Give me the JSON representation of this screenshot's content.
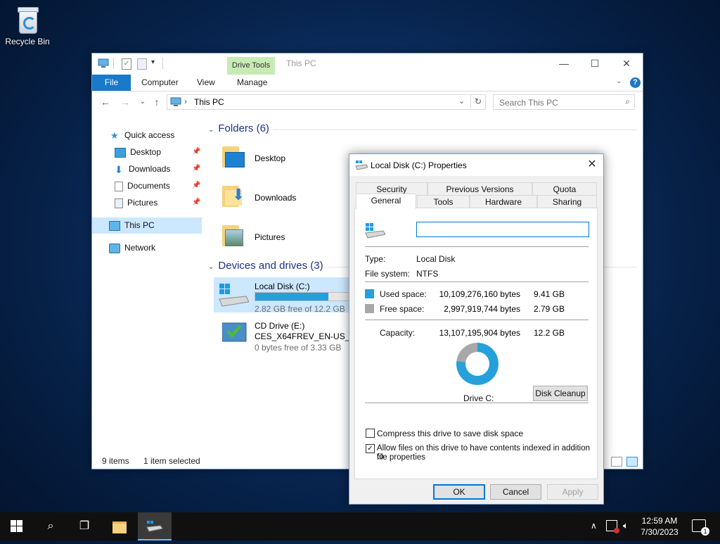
{
  "desktop": {
    "recycle_bin": "Recycle Bin"
  },
  "explorer": {
    "title": "This PC",
    "context_tab": "Drive Tools",
    "tabs": {
      "file": "File",
      "computer": "Computer",
      "view": "View",
      "manage": "Manage"
    },
    "address": "This PC",
    "search_placeholder": "Search This PC",
    "nav": {
      "quick_access": "Quick access",
      "desktop": "Desktop",
      "downloads": "Downloads",
      "documents": "Documents",
      "pictures": "Pictures",
      "this_pc": "This PC",
      "network": "Network"
    },
    "folders_header": "Folders (6)",
    "folders": [
      "Desktop",
      "Downloads",
      "Pictures"
    ],
    "devices_header": "Devices and drives (3)",
    "drive_c": {
      "name": "Local Disk (C:)",
      "free": "2.82 GB free of 12.2 GB",
      "used_fraction": 0.77
    },
    "drive_e": {
      "name": "CD Drive (E:)",
      "label": "CES_X64FREV_EN-US_DV5",
      "free": "0 bytes free of 3.33 GB"
    },
    "status": {
      "items": "9 items",
      "selected": "1 item selected"
    }
  },
  "dialog": {
    "title": "Local Disk (C:) Properties",
    "tabs_row1": [
      "Security",
      "Previous Versions",
      "Quota"
    ],
    "tabs_row2": [
      "General",
      "Tools",
      "Hardware",
      "Sharing"
    ],
    "name_value": "",
    "type_label": "Type:",
    "type_value": "Local Disk",
    "fs_label": "File system:",
    "fs_value": "NTFS",
    "used_label": "Used space:",
    "used_bytes": "10,109,276,160 bytes",
    "used_gb": "9.41 GB",
    "free_label": "Free space:",
    "free_bytes": "2,997,919,744 bytes",
    "free_gb": "2.79 GB",
    "cap_label": "Capacity:",
    "cap_bytes": "13,107,195,904 bytes",
    "cap_gb": "12.2 GB",
    "drive_label": "Drive C:",
    "cleanup": "Disk Cleanup",
    "compress": "Compress this drive to save disk space",
    "index_line1": "Allow files on this drive to have contents indexed in addition to",
    "index_line2": "file properties",
    "index_checked": true,
    "ok": "OK",
    "cancel": "Cancel",
    "apply": "Apply",
    "colors": {
      "used": "#26a0da",
      "free": "#a8a8a8"
    }
  },
  "taskbar": {
    "time": "12:59 AM",
    "date": "7/30/2023",
    "notifications": "1"
  }
}
